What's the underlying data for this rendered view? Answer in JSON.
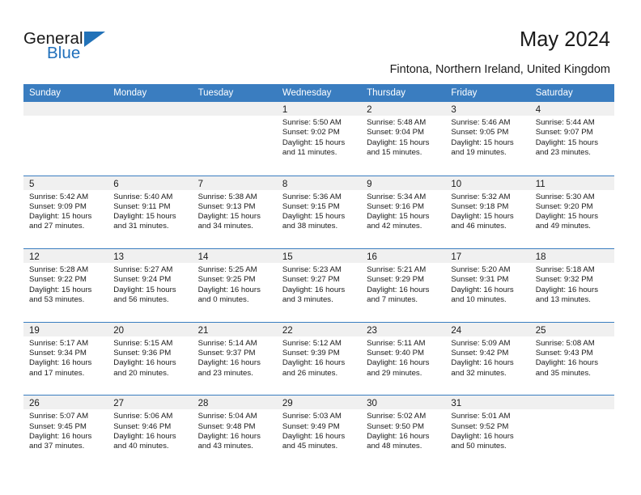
{
  "brand": {
    "name_top": "General",
    "name_bottom": "Blue",
    "accent_color": "#2272b8"
  },
  "header": {
    "title": "May 2024",
    "subtitle": "Fintona, Northern Ireland, United Kingdom"
  },
  "theme": {
    "header_row_bg": "#3a7dc0",
    "day_band_bg": "#f0f0f0",
    "row_divider": "#3a7dc0",
    "text": "#1a1a1a"
  },
  "weekdays": [
    "Sunday",
    "Monday",
    "Tuesday",
    "Wednesday",
    "Thursday",
    "Friday",
    "Saturday"
  ],
  "weeks": [
    [
      {
        "day": "",
        "sunrise": "",
        "sunset": "",
        "daylight1": "",
        "daylight2": ""
      },
      {
        "day": "",
        "sunrise": "",
        "sunset": "",
        "daylight1": "",
        "daylight2": ""
      },
      {
        "day": "",
        "sunrise": "",
        "sunset": "",
        "daylight1": "",
        "daylight2": ""
      },
      {
        "day": "1",
        "sunrise": "Sunrise: 5:50 AM",
        "sunset": "Sunset: 9:02 PM",
        "daylight1": "Daylight: 15 hours",
        "daylight2": "and 11 minutes."
      },
      {
        "day": "2",
        "sunrise": "Sunrise: 5:48 AM",
        "sunset": "Sunset: 9:04 PM",
        "daylight1": "Daylight: 15 hours",
        "daylight2": "and 15 minutes."
      },
      {
        "day": "3",
        "sunrise": "Sunrise: 5:46 AM",
        "sunset": "Sunset: 9:05 PM",
        "daylight1": "Daylight: 15 hours",
        "daylight2": "and 19 minutes."
      },
      {
        "day": "4",
        "sunrise": "Sunrise: 5:44 AM",
        "sunset": "Sunset: 9:07 PM",
        "daylight1": "Daylight: 15 hours",
        "daylight2": "and 23 minutes."
      }
    ],
    [
      {
        "day": "5",
        "sunrise": "Sunrise: 5:42 AM",
        "sunset": "Sunset: 9:09 PM",
        "daylight1": "Daylight: 15 hours",
        "daylight2": "and 27 minutes."
      },
      {
        "day": "6",
        "sunrise": "Sunrise: 5:40 AM",
        "sunset": "Sunset: 9:11 PM",
        "daylight1": "Daylight: 15 hours",
        "daylight2": "and 31 minutes."
      },
      {
        "day": "7",
        "sunrise": "Sunrise: 5:38 AM",
        "sunset": "Sunset: 9:13 PM",
        "daylight1": "Daylight: 15 hours",
        "daylight2": "and 34 minutes."
      },
      {
        "day": "8",
        "sunrise": "Sunrise: 5:36 AM",
        "sunset": "Sunset: 9:15 PM",
        "daylight1": "Daylight: 15 hours",
        "daylight2": "and 38 minutes."
      },
      {
        "day": "9",
        "sunrise": "Sunrise: 5:34 AM",
        "sunset": "Sunset: 9:16 PM",
        "daylight1": "Daylight: 15 hours",
        "daylight2": "and 42 minutes."
      },
      {
        "day": "10",
        "sunrise": "Sunrise: 5:32 AM",
        "sunset": "Sunset: 9:18 PM",
        "daylight1": "Daylight: 15 hours",
        "daylight2": "and 46 minutes."
      },
      {
        "day": "11",
        "sunrise": "Sunrise: 5:30 AM",
        "sunset": "Sunset: 9:20 PM",
        "daylight1": "Daylight: 15 hours",
        "daylight2": "and 49 minutes."
      }
    ],
    [
      {
        "day": "12",
        "sunrise": "Sunrise: 5:28 AM",
        "sunset": "Sunset: 9:22 PM",
        "daylight1": "Daylight: 15 hours",
        "daylight2": "and 53 minutes."
      },
      {
        "day": "13",
        "sunrise": "Sunrise: 5:27 AM",
        "sunset": "Sunset: 9:24 PM",
        "daylight1": "Daylight: 15 hours",
        "daylight2": "and 56 minutes."
      },
      {
        "day": "14",
        "sunrise": "Sunrise: 5:25 AM",
        "sunset": "Sunset: 9:25 PM",
        "daylight1": "Daylight: 16 hours",
        "daylight2": "and 0 minutes."
      },
      {
        "day": "15",
        "sunrise": "Sunrise: 5:23 AM",
        "sunset": "Sunset: 9:27 PM",
        "daylight1": "Daylight: 16 hours",
        "daylight2": "and 3 minutes."
      },
      {
        "day": "16",
        "sunrise": "Sunrise: 5:21 AM",
        "sunset": "Sunset: 9:29 PM",
        "daylight1": "Daylight: 16 hours",
        "daylight2": "and 7 minutes."
      },
      {
        "day": "17",
        "sunrise": "Sunrise: 5:20 AM",
        "sunset": "Sunset: 9:31 PM",
        "daylight1": "Daylight: 16 hours",
        "daylight2": "and 10 minutes."
      },
      {
        "day": "18",
        "sunrise": "Sunrise: 5:18 AM",
        "sunset": "Sunset: 9:32 PM",
        "daylight1": "Daylight: 16 hours",
        "daylight2": "and 13 minutes."
      }
    ],
    [
      {
        "day": "19",
        "sunrise": "Sunrise: 5:17 AM",
        "sunset": "Sunset: 9:34 PM",
        "daylight1": "Daylight: 16 hours",
        "daylight2": "and 17 minutes."
      },
      {
        "day": "20",
        "sunrise": "Sunrise: 5:15 AM",
        "sunset": "Sunset: 9:36 PM",
        "daylight1": "Daylight: 16 hours",
        "daylight2": "and 20 minutes."
      },
      {
        "day": "21",
        "sunrise": "Sunrise: 5:14 AM",
        "sunset": "Sunset: 9:37 PM",
        "daylight1": "Daylight: 16 hours",
        "daylight2": "and 23 minutes."
      },
      {
        "day": "22",
        "sunrise": "Sunrise: 5:12 AM",
        "sunset": "Sunset: 9:39 PM",
        "daylight1": "Daylight: 16 hours",
        "daylight2": "and 26 minutes."
      },
      {
        "day": "23",
        "sunrise": "Sunrise: 5:11 AM",
        "sunset": "Sunset: 9:40 PM",
        "daylight1": "Daylight: 16 hours",
        "daylight2": "and 29 minutes."
      },
      {
        "day": "24",
        "sunrise": "Sunrise: 5:09 AM",
        "sunset": "Sunset: 9:42 PM",
        "daylight1": "Daylight: 16 hours",
        "daylight2": "and 32 minutes."
      },
      {
        "day": "25",
        "sunrise": "Sunrise: 5:08 AM",
        "sunset": "Sunset: 9:43 PM",
        "daylight1": "Daylight: 16 hours",
        "daylight2": "and 35 minutes."
      }
    ],
    [
      {
        "day": "26",
        "sunrise": "Sunrise: 5:07 AM",
        "sunset": "Sunset: 9:45 PM",
        "daylight1": "Daylight: 16 hours",
        "daylight2": "and 37 minutes."
      },
      {
        "day": "27",
        "sunrise": "Sunrise: 5:06 AM",
        "sunset": "Sunset: 9:46 PM",
        "daylight1": "Daylight: 16 hours",
        "daylight2": "and 40 minutes."
      },
      {
        "day": "28",
        "sunrise": "Sunrise: 5:04 AM",
        "sunset": "Sunset: 9:48 PM",
        "daylight1": "Daylight: 16 hours",
        "daylight2": "and 43 minutes."
      },
      {
        "day": "29",
        "sunrise": "Sunrise: 5:03 AM",
        "sunset": "Sunset: 9:49 PM",
        "daylight1": "Daylight: 16 hours",
        "daylight2": "and 45 minutes."
      },
      {
        "day": "30",
        "sunrise": "Sunrise: 5:02 AM",
        "sunset": "Sunset: 9:50 PM",
        "daylight1": "Daylight: 16 hours",
        "daylight2": "and 48 minutes."
      },
      {
        "day": "31",
        "sunrise": "Sunrise: 5:01 AM",
        "sunset": "Sunset: 9:52 PM",
        "daylight1": "Daylight: 16 hours",
        "daylight2": "and 50 minutes."
      },
      {
        "day": "",
        "sunrise": "",
        "sunset": "",
        "daylight1": "",
        "daylight2": ""
      }
    ]
  ]
}
